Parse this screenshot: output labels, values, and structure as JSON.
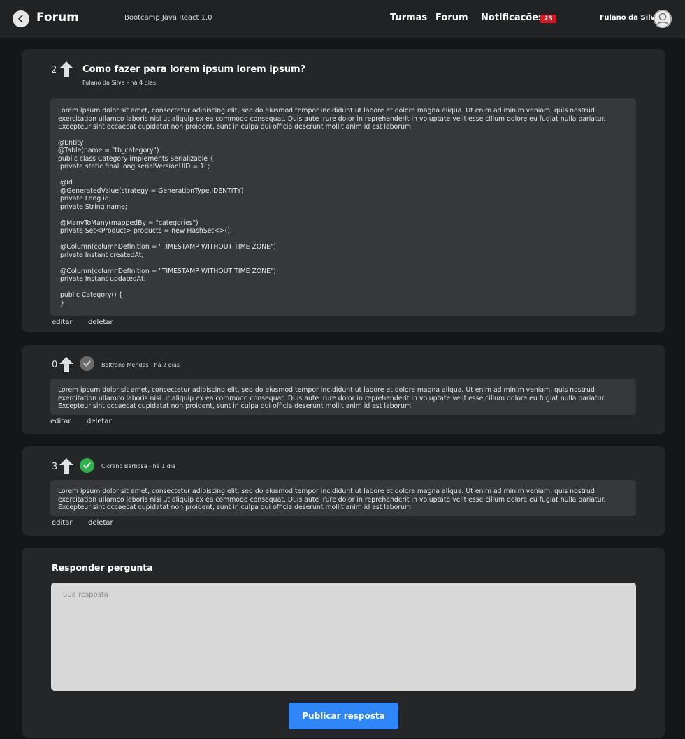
{
  "header": {
    "title": "Forum",
    "subtitle": "Bootcamp Java React 1.0",
    "nav": [
      "Turmas",
      "Forum",
      "Notificações"
    ],
    "notification_count": "23",
    "user_name": "Fulano da Silva"
  },
  "question": {
    "votes": "2",
    "title": "Como fazer para lorem ipsum lorem ipsum?",
    "meta": "Fulano da Silva - há 4 dias",
    "text": "Lorem ipsum dolor sit amet, consectetur adipiscing elit, sed do eiusmod tempor incididunt ut labore et dolore magna aliqua. Ut enim ad minim veniam, quis nostrud exercitation ullamco laboris nisi ut aliquip ex ea commodo consequat. Duis aute irure dolor in reprehenderit in voluptate velit esse cillum dolore eu fugiat nulla pariatur. Excepteur sint occaecat cupidatat non proident, sunt in culpa qui officia deserunt mollit anim id est laborum.",
    "code": "@Entity\n@Table(name = \"tb_category\")\npublic class Category implements Serializable {\n private static final long serialVersionUID = 1L;\n\n @Id\n @GeneratedValue(strategy = GenerationType.IDENTITY)\n private Long id;\n private String name;\n\n @ManyToMany(mappedBy = \"categories\")\n private Set<Product> products = new HashSet<>();\n\n @Column(columnDefinition = \"TIMESTAMP WITHOUT TIME ZONE\")\n private Instant createdAt;\n\n @Column(columnDefinition = \"TIMESTAMP WITHOUT TIME ZONE\")\n private Instant updatedAt;\n\n public Category() {\n }",
    "edit_label": "editar",
    "delete_label": "deletar"
  },
  "answers": [
    {
      "votes": "0",
      "accepted": false,
      "meta": "Beltrano Mendes - há 2 dias",
      "text": "Lorem ipsum dolor sit amet, consectetur adipiscing elit, sed do eiusmod tempor incididunt ut labore et dolore magna aliqua. Ut enim ad minim veniam, quis nostrud exercitation ullamco laboris nisi ut aliquip ex ea commodo consequat. Duis aute irure dolor in reprehenderit in voluptate velit esse cillum dolore eu fugiat nulla pariatur. Excepteur sint occaecat cupidatat non proident, sunt in culpa qui officia deserunt mollit anim id est laborum.",
      "edit_label": "editar",
      "delete_label": "deletar"
    },
    {
      "votes": "3",
      "accepted": true,
      "meta": "Cicrano Barbosa - há 1 dia",
      "text": "Lorem ipsum dolor sit amet, consectetur adipiscing elit, sed do eiusmod tempor incididunt ut labore et dolore magna aliqua. Ut enim ad minim veniam, quis nostrud exercitation ullamco laboris nisi ut aliquip ex ea commodo consequat. Duis aute irure dolor in reprehenderit in voluptate velit esse cillum dolore eu fugiat nulla pariatur. Excepteur sint occaecat cupidatat non proident, sunt in culpa qui officia deserunt mollit anim id est laborum.",
      "edit_label": "editar",
      "delete_label": "deletar"
    }
  ],
  "reply": {
    "title": "Responder pergunta",
    "placeholder": "Sua resposta",
    "button_label": "Publicar resposta"
  },
  "colors": {
    "accent": "#2f86f6",
    "badge": "#e0151b",
    "accepted": "#2fb24c",
    "not_accepted": "#6b6b6b"
  },
  "icons": {
    "back": "chevron-left-icon",
    "upvote": "arrow-up-icon",
    "accept": "check-circle-icon",
    "avatar": "user-avatar-icon"
  }
}
